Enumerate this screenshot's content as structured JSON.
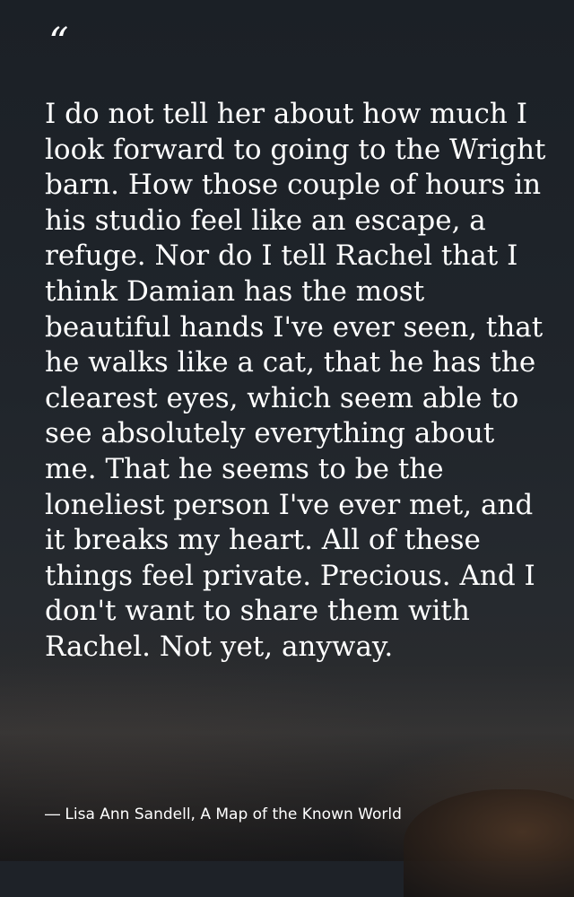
{
  "quote": {
    "mark": "“",
    "text": "I do not tell her about how much I look forward to going to the Wright barn. How those couple of hours in his studio feel like an escape, a refuge. Nor do I tell Rachel that I think Damian has the most beautiful hands I've ever seen, that he walks like a cat, that he has the clearest eyes, which seem able to see absolutely everything about me. That he seems to be the loneliest person I've ever met, and it breaks my heart. All of these things feel private. Precious. And I don't want to share them with Rachel. Not yet, anyway.",
    "attribution": "― Lisa Ann Sandell, A Map of the Known World"
  }
}
